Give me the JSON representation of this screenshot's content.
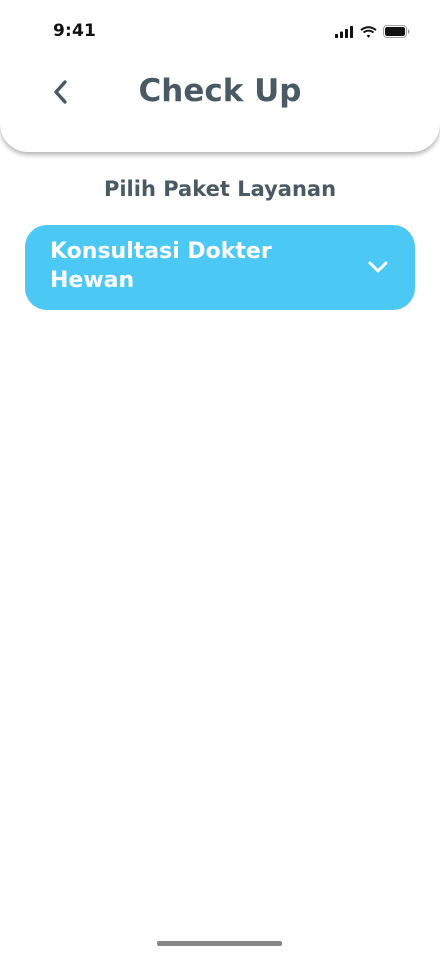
{
  "status_bar": {
    "time": "9:41",
    "icons": [
      "cellular-signal-icon",
      "wifi-icon",
      "battery-icon"
    ]
  },
  "header": {
    "back_icon": "chevron-left-icon",
    "title": "Check Up"
  },
  "main": {
    "section_title": "Pilih Paket Layanan",
    "package_select": {
      "selected_value": "Konsultasi Dokter Hewan",
      "icon": "chevron-down-icon"
    }
  },
  "colors": {
    "accent": "#4cc8f5",
    "title_text": "#4a5a65",
    "background": "#ffffff"
  }
}
